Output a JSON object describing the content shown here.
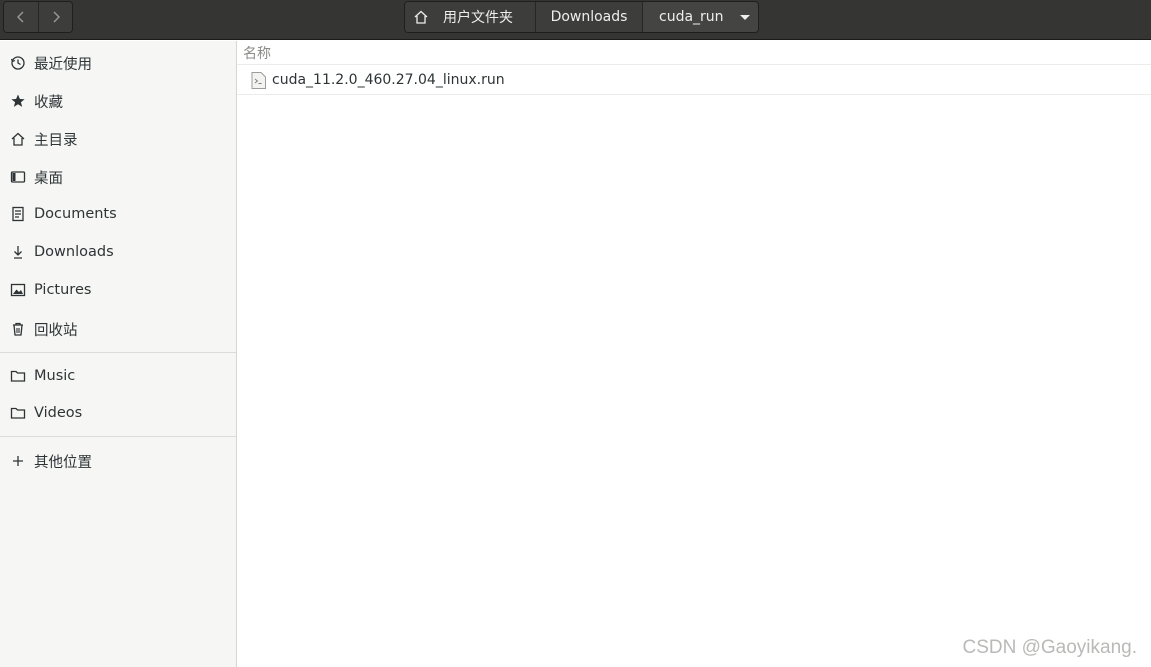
{
  "header": {
    "breadcrumbs": [
      {
        "label": "用户文件夹",
        "icon": "home-icon"
      },
      {
        "label": "Downloads"
      },
      {
        "label": "cuda_run",
        "icon": "caret-down-icon"
      }
    ]
  },
  "sidebar": {
    "items": [
      {
        "label": "最近使用",
        "icon": "clock-icon"
      },
      {
        "label": "收藏",
        "icon": "star-icon"
      },
      {
        "label": "主目录",
        "icon": "home-icon"
      },
      {
        "label": "桌面",
        "icon": "desktop-icon"
      },
      {
        "label": "Documents",
        "icon": "document-icon"
      },
      {
        "label": "Downloads",
        "icon": "download-icon"
      },
      {
        "label": "Pictures",
        "icon": "picture-icon"
      },
      {
        "label": "回收站",
        "icon": "trash-icon"
      },
      {
        "label": "Music",
        "icon": "folder-icon"
      },
      {
        "label": "Videos",
        "icon": "folder-icon"
      },
      {
        "label": "其他位置",
        "icon": "plus-icon"
      }
    ]
  },
  "main": {
    "column_header": "名称",
    "files": [
      {
        "name": "cuda_11.2.0_460.27.04_linux.run",
        "icon": "script-file-icon"
      }
    ]
  },
  "watermark": "CSDN @Gaoyikang.",
  "colors": {
    "header_bg": "#353533",
    "sidebar_bg": "#f6f6f5",
    "text": "#2e3436"
  }
}
